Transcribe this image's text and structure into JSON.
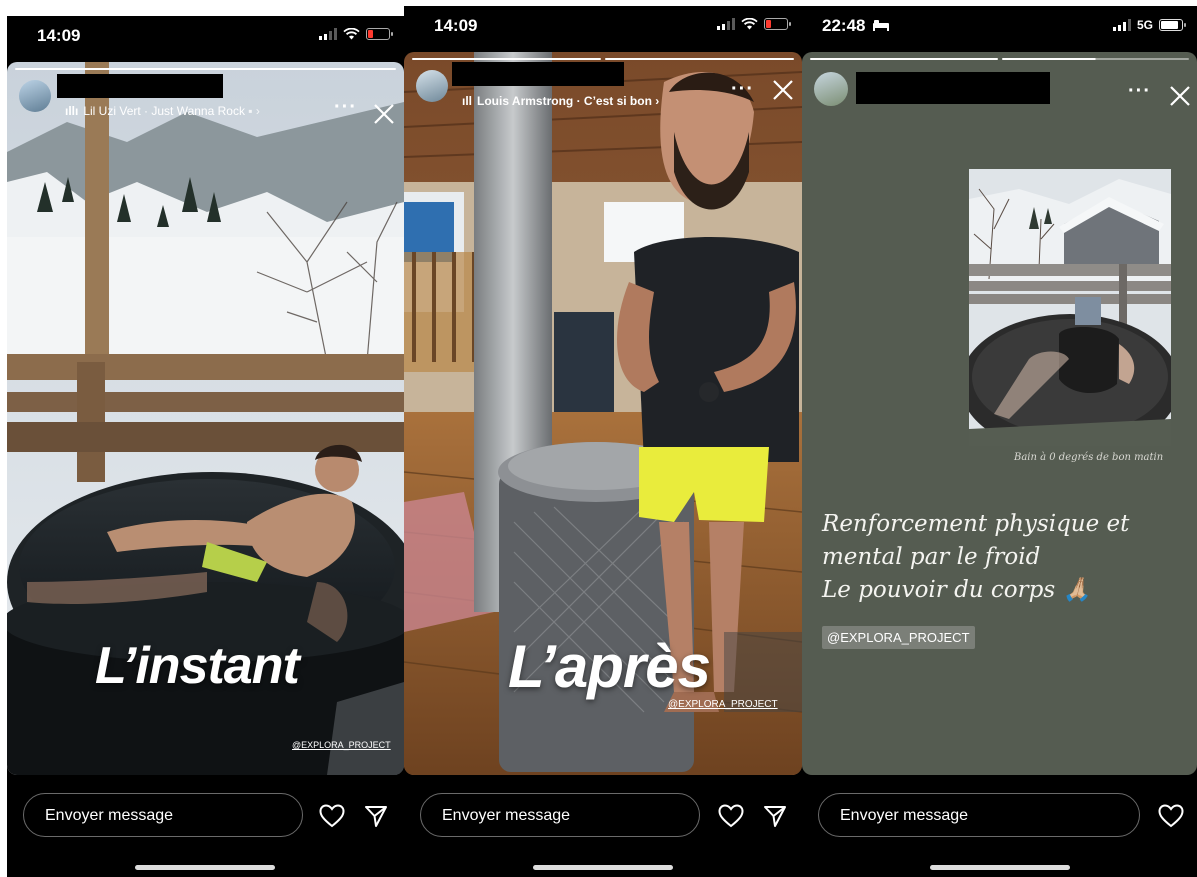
{
  "screens": [
    {
      "status": {
        "time": "14:09"
      },
      "music": "Lil Uzi Vert · Just Wanna Rock",
      "overlay_text": "L’instant",
      "credit": "@EXPLORA_PROJECT",
      "message_placeholder": "Envoyer message"
    },
    {
      "status": {
        "time": "14:09"
      },
      "music": "Louis Armstrong · C’est si bon",
      "overlay_text": "L’après",
      "credit": "@EXPLORA_PROJECT",
      "message_placeholder": "Envoyer message"
    },
    {
      "status": {
        "time": "22:48",
        "network": "5G"
      },
      "photo_caption": "Bain à 0 degrés de bon matin",
      "text_lines": [
        "Renforcement physique et",
        "mental par le froid",
        "Le pouvoir du corps 🙏🏼"
      ],
      "mention": "@EXPLORA_PROJECT",
      "message_placeholder": "Envoyer message"
    }
  ],
  "icons": {
    "like": "heart-icon",
    "share": "send-icon",
    "close": "close-icon",
    "more": "more-icon",
    "music": "music-icon",
    "wifi": "wifi-icon",
    "signal": "signal-icon",
    "battery": "battery-icon",
    "sleep_mode": "bed-icon"
  },
  "colors": {
    "battery_low": "#ff3b30",
    "accent_yellow": "#f0e53a",
    "story3_bg": "#555c51"
  }
}
